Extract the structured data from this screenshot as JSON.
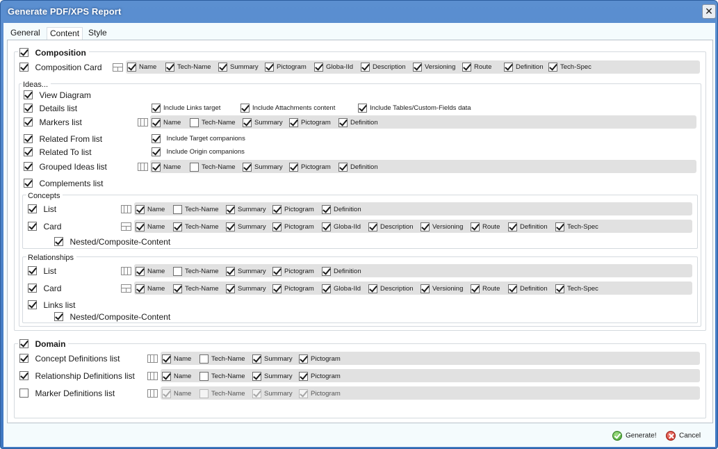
{
  "window": {
    "title": "Generate PDF/XPS Report",
    "close_glyph": "✕"
  },
  "tabs": [
    {
      "label": "General",
      "active": false
    },
    {
      "label": "Content",
      "active": true
    },
    {
      "label": "Style",
      "active": false
    }
  ],
  "composition": {
    "label": "Composition",
    "checked": true,
    "card": {
      "label": "Composition Card",
      "checked": true,
      "layout": "card-layout-icon",
      "options": [
        {
          "label": "Name",
          "checked": true
        },
        {
          "label": "Tech-Name",
          "checked": true
        },
        {
          "label": "Summary",
          "checked": true
        },
        {
          "label": "Pictogram",
          "checked": true
        },
        {
          "label": "Globa-IId",
          "checked": true
        },
        {
          "label": "Description",
          "checked": true
        },
        {
          "label": "Versioning",
          "checked": true
        },
        {
          "label": "Route",
          "checked": true
        },
        {
          "label": "Definition",
          "checked": true
        },
        {
          "label": "Tech-Spec",
          "checked": true
        }
      ]
    },
    "ideas": {
      "label": "Ideas...",
      "view_diagram": {
        "label": "View Diagram",
        "checked": true
      },
      "details_list": {
        "label": "Details list",
        "checked": true,
        "options": [
          {
            "label": "Include Links target",
            "checked": true
          },
          {
            "label": "Include Attachments content",
            "checked": true
          },
          {
            "label": "Include Tables/Custom-Fields data",
            "checked": true
          }
        ]
      },
      "markers_list": {
        "label": "Markers list",
        "checked": true,
        "layout": "table-layout-icon",
        "options": [
          {
            "label": "Name",
            "checked": true
          },
          {
            "label": "Tech-Name",
            "checked": false
          },
          {
            "label": "Summary",
            "checked": true
          },
          {
            "label": "Pictogram",
            "checked": true
          },
          {
            "label": "Definition",
            "checked": true
          }
        ]
      },
      "related_from": {
        "label": "Related From list",
        "checked": true,
        "option": {
          "label": "Include Target companions",
          "checked": true
        }
      },
      "related_to": {
        "label": "Related To list",
        "checked": true,
        "option": {
          "label": "Include Origin companions",
          "checked": true
        }
      },
      "grouped_ideas": {
        "label": "Grouped Ideas list",
        "checked": true,
        "layout": "table-layout-icon",
        "options": [
          {
            "label": "Name",
            "checked": true
          },
          {
            "label": "Tech-Name",
            "checked": false
          },
          {
            "label": "Summary",
            "checked": true
          },
          {
            "label": "Pictogram",
            "checked": true
          },
          {
            "label": "Definition",
            "checked": true
          }
        ]
      },
      "complements": {
        "label": "Complements list",
        "checked": true
      },
      "concepts": {
        "label": "Concepts",
        "list": {
          "label": "List",
          "checked": true,
          "options": [
            {
              "label": "Name",
              "checked": true
            },
            {
              "label": "Tech-Name",
              "checked": false
            },
            {
              "label": "Summary",
              "checked": true
            },
            {
              "label": "Pictogram",
              "checked": true
            },
            {
              "label": "Definition",
              "checked": true
            }
          ]
        },
        "card": {
          "label": "Card",
          "checked": true,
          "options": [
            {
              "label": "Name",
              "checked": true
            },
            {
              "label": "Tech-Name",
              "checked": true
            },
            {
              "label": "Summary",
              "checked": true
            },
            {
              "label": "Pictogram",
              "checked": true
            },
            {
              "label": "Globa-IId",
              "checked": true
            },
            {
              "label": "Description",
              "checked": true
            },
            {
              "label": "Versioning",
              "checked": true
            },
            {
              "label": "Route",
              "checked": true
            },
            {
              "label": "Definition",
              "checked": true
            },
            {
              "label": "Tech-Spec",
              "checked": true
            }
          ]
        },
        "nested": {
          "label": "Nested/Composite-Content",
          "checked": true
        }
      },
      "relationships": {
        "label": "Relationships",
        "list": {
          "label": "List",
          "checked": true,
          "options": [
            {
              "label": "Name",
              "checked": true
            },
            {
              "label": "Tech-Name",
              "checked": false
            },
            {
              "label": "Summary",
              "checked": true
            },
            {
              "label": "Pictogram",
              "checked": true
            },
            {
              "label": "Definition",
              "checked": true
            }
          ]
        },
        "card": {
          "label": "Card",
          "checked": true,
          "options": [
            {
              "label": "Name",
              "checked": true
            },
            {
              "label": "Tech-Name",
              "checked": true
            },
            {
              "label": "Summary",
              "checked": true
            },
            {
              "label": "Pictogram",
              "checked": true
            },
            {
              "label": "Globa-IId",
              "checked": true
            },
            {
              "label": "Description",
              "checked": true
            },
            {
              "label": "Versioning",
              "checked": true
            },
            {
              "label": "Route",
              "checked": true
            },
            {
              "label": "Definition",
              "checked": true
            },
            {
              "label": "Tech-Spec",
              "checked": true
            }
          ]
        },
        "links_list": {
          "label": "Links list",
          "checked": true
        },
        "nested": {
          "label": "Nested/Composite-Content",
          "checked": true
        }
      }
    }
  },
  "domain": {
    "label": "Domain",
    "checked": true,
    "concept_defs": {
      "label": "Concept Definitions list",
      "checked": true,
      "options": [
        {
          "label": "Name",
          "checked": true
        },
        {
          "label": "Tech-Name",
          "checked": false
        },
        {
          "label": "Summary",
          "checked": true
        },
        {
          "label": "Pictogram",
          "checked": true
        }
      ]
    },
    "relationship_defs": {
      "label": "Relationship Definitions list",
      "checked": true,
      "options": [
        {
          "label": "Name",
          "checked": true
        },
        {
          "label": "Tech-Name",
          "checked": false
        },
        {
          "label": "Summary",
          "checked": true
        },
        {
          "label": "Pictogram",
          "checked": true
        }
      ]
    },
    "marker_defs": {
      "label": "Marker Definitions list",
      "checked": false,
      "options": [
        {
          "label": "Name",
          "checked": true
        },
        {
          "label": "Tech-Name",
          "checked": false
        },
        {
          "label": "Summary",
          "checked": true
        },
        {
          "label": "Pictogram",
          "checked": true
        }
      ]
    }
  },
  "footer": {
    "generate_label": "Generate!",
    "cancel_label": "Cancel"
  }
}
